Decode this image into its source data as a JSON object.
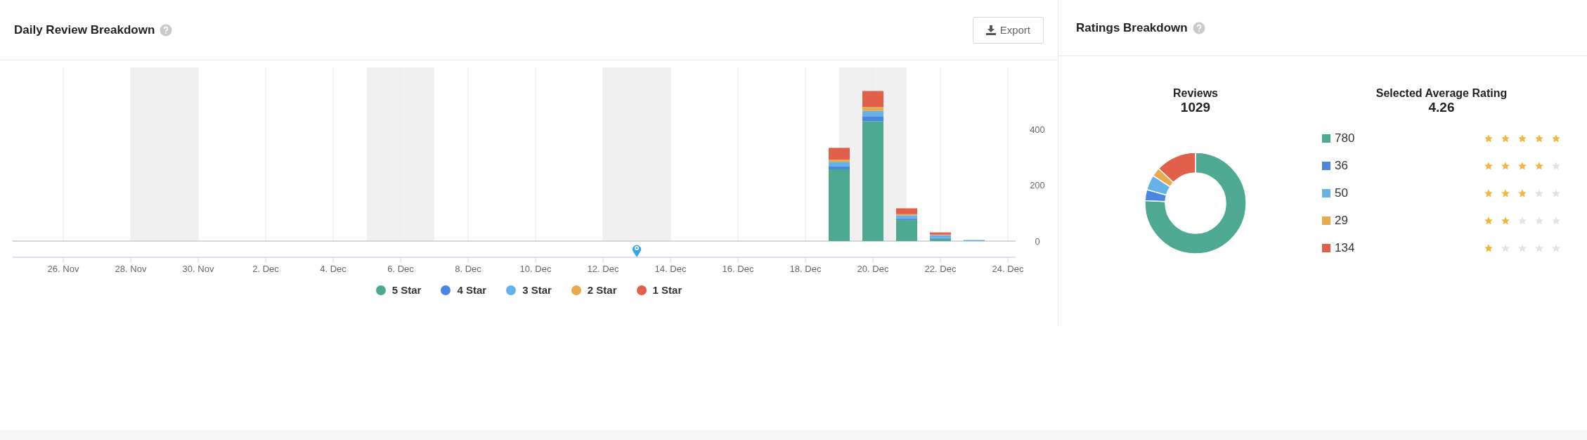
{
  "daily_panel": {
    "title": "Daily Review Breakdown",
    "export_button": "Export",
    "chart_data": {
      "type": "bar",
      "stacked": true,
      "grid": true,
      "categories": [
        null,
        "26. Nov",
        null,
        "28. Nov",
        null,
        "30. Nov",
        null,
        "2. Dec",
        null,
        "4. Dec",
        null,
        "6. Dec",
        null,
        "8. Dec",
        null,
        "10. Dec",
        null,
        "12. Dec",
        null,
        "14. Dec",
        null,
        "16. Dec",
        null,
        "18. Dec",
        null,
        "20. Dec",
        null,
        "22. Dec",
        null,
        "24. Dec"
      ],
      "series": [
        {
          "name": "5 Star",
          "color": "#4ea992",
          "values": [
            null,
            null,
            null,
            null,
            null,
            null,
            null,
            null,
            null,
            null,
            null,
            null,
            null,
            null,
            null,
            null,
            null,
            null,
            null,
            null,
            null,
            null,
            null,
            null,
            256,
            428,
            75,
            8,
            null,
            null
          ]
        },
        {
          "name": "4 Star",
          "color": "#4a86e0",
          "values": [
            null,
            null,
            null,
            null,
            null,
            null,
            null,
            null,
            null,
            null,
            null,
            null,
            null,
            null,
            null,
            null,
            null,
            null,
            null,
            null,
            null,
            null,
            null,
            null,
            10,
            18,
            5,
            3,
            null,
            null
          ]
        },
        {
          "name": "3 Star",
          "color": "#66b1ea",
          "values": [
            null,
            null,
            null,
            null,
            null,
            null,
            null,
            null,
            null,
            null,
            null,
            null,
            null,
            null,
            null,
            null,
            null,
            null,
            null,
            null,
            null,
            null,
            null,
            null,
            17,
            19,
            12,
            10,
            4,
            null
          ]
        },
        {
          "name": "2 Star",
          "color": "#e8a94f",
          "values": [
            null,
            null,
            null,
            null,
            null,
            null,
            null,
            null,
            null,
            null,
            null,
            null,
            null,
            null,
            null,
            null,
            null,
            null,
            null,
            null,
            null,
            null,
            null,
            null,
            8,
            14,
            4,
            2,
            null,
            null
          ]
        },
        {
          "name": "1 Star",
          "color": "#e0604a",
          "values": [
            null,
            null,
            null,
            null,
            null,
            null,
            null,
            null,
            null,
            null,
            null,
            null,
            null,
            null,
            null,
            null,
            null,
            null,
            null,
            null,
            null,
            null,
            null,
            null,
            42,
            57,
            21,
            8,
            null,
            null
          ]
        }
      ],
      "yticks": [
        {
          "value": 0,
          "label": "0"
        },
        {
          "value": 200,
          "label": "200"
        },
        {
          "value": 400,
          "label": "400"
        }
      ],
      "ylim": [
        0,
        620
      ]
    }
  },
  "ratings_panel": {
    "title": "Ratings Breakdown",
    "reviews": {
      "label": "Reviews",
      "value": "1029"
    },
    "average": {
      "label": "Selected Average Rating",
      "value": "4.26"
    },
    "chart_data": {
      "type": "donut",
      "categories": [
        "780",
        "36",
        "50",
        "29",
        "134"
      ],
      "values": [
        780,
        36,
        50,
        29,
        134
      ]
    },
    "ratings": [
      {
        "color": "#4ea992",
        "stars": 5
      },
      {
        "color": "#4a86e0",
        "stars": 4
      },
      {
        "color": "#66b1ea",
        "stars": 3
      },
      {
        "color": "#e8a94f",
        "stars": 2
      },
      {
        "color": "#e0604a",
        "stars": 1
      }
    ]
  }
}
